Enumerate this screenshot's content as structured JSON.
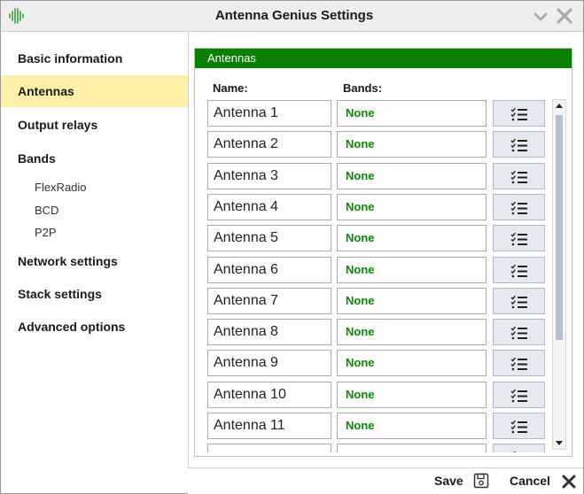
{
  "window": {
    "title": "Antenna Genius Settings",
    "icons": {
      "logo": "antenna-genius-logo",
      "minimize": "chevron-down-icon",
      "close": "close-icon"
    }
  },
  "sidebar": {
    "items": [
      {
        "label": "Basic information"
      },
      {
        "label": "Antennas",
        "active": true
      },
      {
        "label": "Output relays"
      },
      {
        "label": "Bands"
      },
      {
        "label": "FlexRadio",
        "sub": true
      },
      {
        "label": "BCD",
        "sub": true
      },
      {
        "label": "P2P",
        "sub": true
      },
      {
        "label": "Network settings"
      },
      {
        "label": "Stack settings"
      },
      {
        "label": "Advanced options"
      }
    ]
  },
  "panel": {
    "header": "Antennas",
    "name_header": "Name:",
    "bands_header": "Bands:",
    "rows": [
      {
        "name": "Antenna 1",
        "bands": "None"
      },
      {
        "name": "Antenna 2",
        "bands": "None"
      },
      {
        "name": "Antenna 3",
        "bands": "None"
      },
      {
        "name": "Antenna 4",
        "bands": "None"
      },
      {
        "name": "Antenna 5",
        "bands": "None"
      },
      {
        "name": "Antenna 6",
        "bands": "None"
      },
      {
        "name": "Antenna 7",
        "bands": "None"
      },
      {
        "name": "Antenna 8",
        "bands": "None"
      },
      {
        "name": "Antenna 9",
        "bands": "None"
      },
      {
        "name": "Antenna 10",
        "bands": "None"
      },
      {
        "name": "Antenna 11",
        "bands": "None"
      },
      {
        "name": "",
        "bands": ""
      }
    ],
    "edit_icon": "checklist-icon"
  },
  "footer": {
    "save_label": "Save",
    "cancel_label": "Cancel",
    "save_icon": "floppy-disk-icon",
    "cancel_icon": "close-icon"
  },
  "colors": {
    "accent_green": "#0a8000",
    "bands_text": "#0a8a00",
    "active_item": "#fff0a8",
    "button_bg": "#e6e9f0"
  }
}
